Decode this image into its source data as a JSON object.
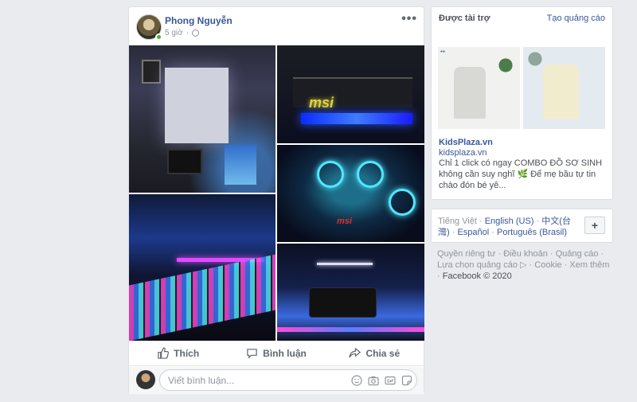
{
  "post": {
    "author": "Phong Nguyễn",
    "time": "5 giờ",
    "actions": {
      "like": "Thích",
      "comment": "Bình luận",
      "share": "Chia sẻ"
    },
    "photo_labels": {
      "gpu_brand": "msi",
      "mobo_brand": "msi"
    },
    "comment_placeholder": "Viết bình luận..."
  },
  "sponsored": {
    "heading": "Được tài trợ",
    "create_ad": "Tạo quảng cáo",
    "title": "KidsPlaza.vn",
    "url": "kidsplaza.vn",
    "description": "Chỉ 1 click có ngay COMBO ĐỒ SƠ SINH không cần suy nghĩ 🌿 Để mẹ bầu tự tin chào đón bé yê..."
  },
  "languages": {
    "current": "Tiếng Việt",
    "options": [
      "English (US)",
      "中文(台灣)",
      "Español",
      "Português (Brasil)"
    ],
    "more_button": "+"
  },
  "footer": {
    "links": [
      "Quyền riêng tư",
      "Điều khoản",
      "Quảng cáo",
      "Lựa chọn quảng cáo",
      "Cookie",
      "Xem thêm"
    ],
    "copyright": "Facebook © 2020"
  },
  "colors": {
    "link": "#385898",
    "background": "#e9ebee",
    "online": "#42b72a"
  }
}
